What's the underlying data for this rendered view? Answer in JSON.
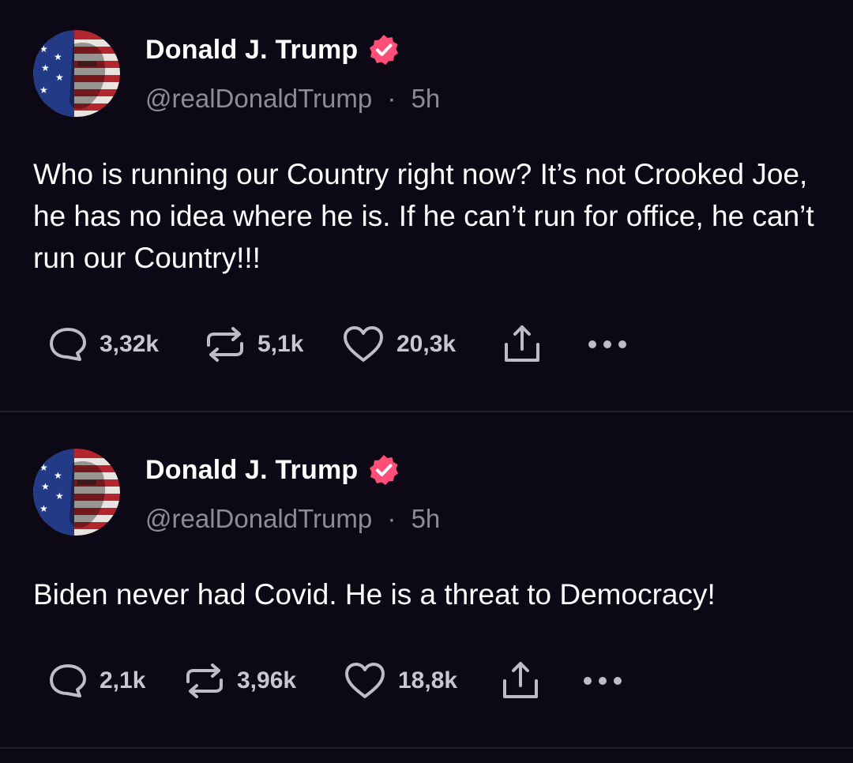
{
  "colors": {
    "background": "#0c0816",
    "text_primary": "#ffffff",
    "text_secondary": "#8e8a99",
    "icon": "#bfbcc7",
    "verified_badge": "#ff4f79",
    "divider": "#221e2e"
  },
  "posts": [
    {
      "author": {
        "name": "Donald J. Trump",
        "handle": "@realDonaldTrump",
        "separator": "·",
        "time": "5h",
        "verified": true,
        "avatar_icon": "flag-face-avatar"
      },
      "text": "Who is running our Country right now? It’s not Crooked Joe, he has no idea where he is. If he can’t run for office, he can’t run our Country!!!",
      "actions": {
        "replies": "3,32k",
        "reposts": "5,1k",
        "likes": "20,3k"
      }
    },
    {
      "author": {
        "name": "Donald J. Trump",
        "handle": "@realDonaldTrump",
        "separator": "·",
        "time": "5h",
        "verified": true,
        "avatar_icon": "flag-face-avatar"
      },
      "text": "Biden never had Covid. He is a threat to Democracy!",
      "actions": {
        "replies": "2,1k",
        "reposts": "3,96k",
        "likes": "18,8k"
      }
    }
  ],
  "icons": {
    "reply": "speech-bubble-icon",
    "repost": "repost-arrows-icon",
    "like": "heart-icon",
    "share": "share-upload-icon",
    "more": "more-dots-icon",
    "verified": "verified-badge-icon"
  }
}
